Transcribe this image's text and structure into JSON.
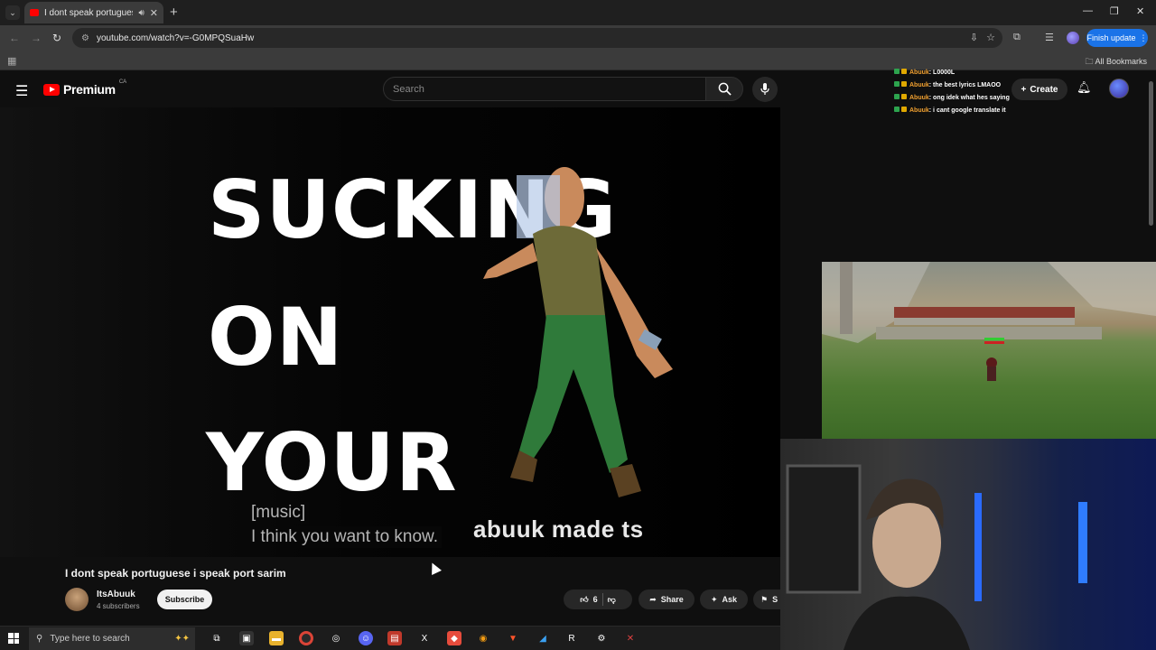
{
  "browser": {
    "tab_title": "I dont speak portuguese i s",
    "url": "youtube.com/watch?v=-G0MPQSuaHw",
    "finish_update": "Finish update",
    "all_bookmarks": "All Bookmarks"
  },
  "youtube": {
    "logo_text": "Premium",
    "region": "CA",
    "search_placeholder": "Search",
    "create_label": "Create"
  },
  "chat": [
    {
      "user": "Abuuk",
      "message": ": L0000L"
    },
    {
      "user": "Abuuk",
      "message": ": the best lyrics LMAOO"
    },
    {
      "user": "Abuuk",
      "message": ": ong idek what hes saying"
    },
    {
      "user": "Abuuk",
      "message": ": i cant google translate it"
    }
  ],
  "video": {
    "lyric_line1": "SUCKING",
    "lyric_line2": "ON",
    "lyric_line3": "YOUR",
    "caption_line1": "[music]",
    "caption_line2": "I think you want to know.",
    "watermark": "abuuk made ts",
    "title": "I dont speak portuguese i speak port sarim",
    "channel": "ItsAbuuk",
    "subscribers": "4 subscribers",
    "subscribe_label": "Subscribe",
    "likes": "6",
    "share_label": "Share",
    "ask_label": "Ask",
    "save_label": "S"
  },
  "taskbar": {
    "search_placeholder": "Type here to search"
  },
  "colors": {
    "yt_red": "#ff0000",
    "accent_blue": "#1a73e8",
    "chat_user": "#f0a030"
  }
}
